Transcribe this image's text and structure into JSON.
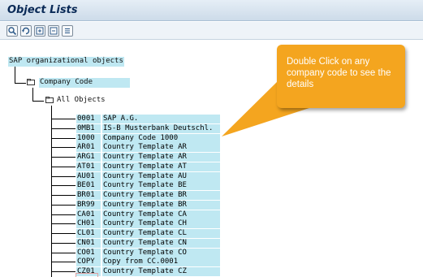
{
  "window": {
    "title": "Object Lists"
  },
  "toolbar": {
    "buttons": [
      {
        "icon": "find-icon"
      },
      {
        "icon": "refresh-icon"
      },
      {
        "icon": "expand-icon"
      },
      {
        "icon": "collapse-icon"
      },
      {
        "icon": "list-icon"
      }
    ]
  },
  "tree": {
    "root": "SAP organizational objects",
    "company_code": "Company Code",
    "all_objects": "All Objects",
    "items": [
      {
        "code": "0001",
        "name": "SAP A.G."
      },
      {
        "code": "0MB1",
        "name": "IS-B Musterbank Deutschl."
      },
      {
        "code": "1000",
        "name": "Company Code 1000"
      },
      {
        "code": "AR01",
        "name": "Country Template AR"
      },
      {
        "code": "ARG1",
        "name": "Country Template AR"
      },
      {
        "code": "AT01",
        "name": "Country Template AT"
      },
      {
        "code": "AU01",
        "name": "Country Template AU"
      },
      {
        "code": "BE01",
        "name": "Country Template BE"
      },
      {
        "code": "BR01",
        "name": "Country Template BR"
      },
      {
        "code": "BR99",
        "name": "Country Template BR"
      },
      {
        "code": "CA01",
        "name": "Country Template CA"
      },
      {
        "code": "CH01",
        "name": "Country Template CH"
      },
      {
        "code": "CL01",
        "name": "Country Template CL"
      },
      {
        "code": "CN01",
        "name": "Country Template CN"
      },
      {
        "code": "CO01",
        "name": "Country Template CO"
      },
      {
        "code": "COPY",
        "name": "Copy from CC.0001"
      },
      {
        "code": "CZ01",
        "name": "Country Template CZ"
      }
    ]
  },
  "callout": {
    "text": "Double Click on  any company code to see the details",
    "color": "#f4a51f"
  },
  "colors": {
    "highlight": "#bfe8f2",
    "titlebar": "#cddbe9",
    "title_text": "#0a2a57"
  }
}
